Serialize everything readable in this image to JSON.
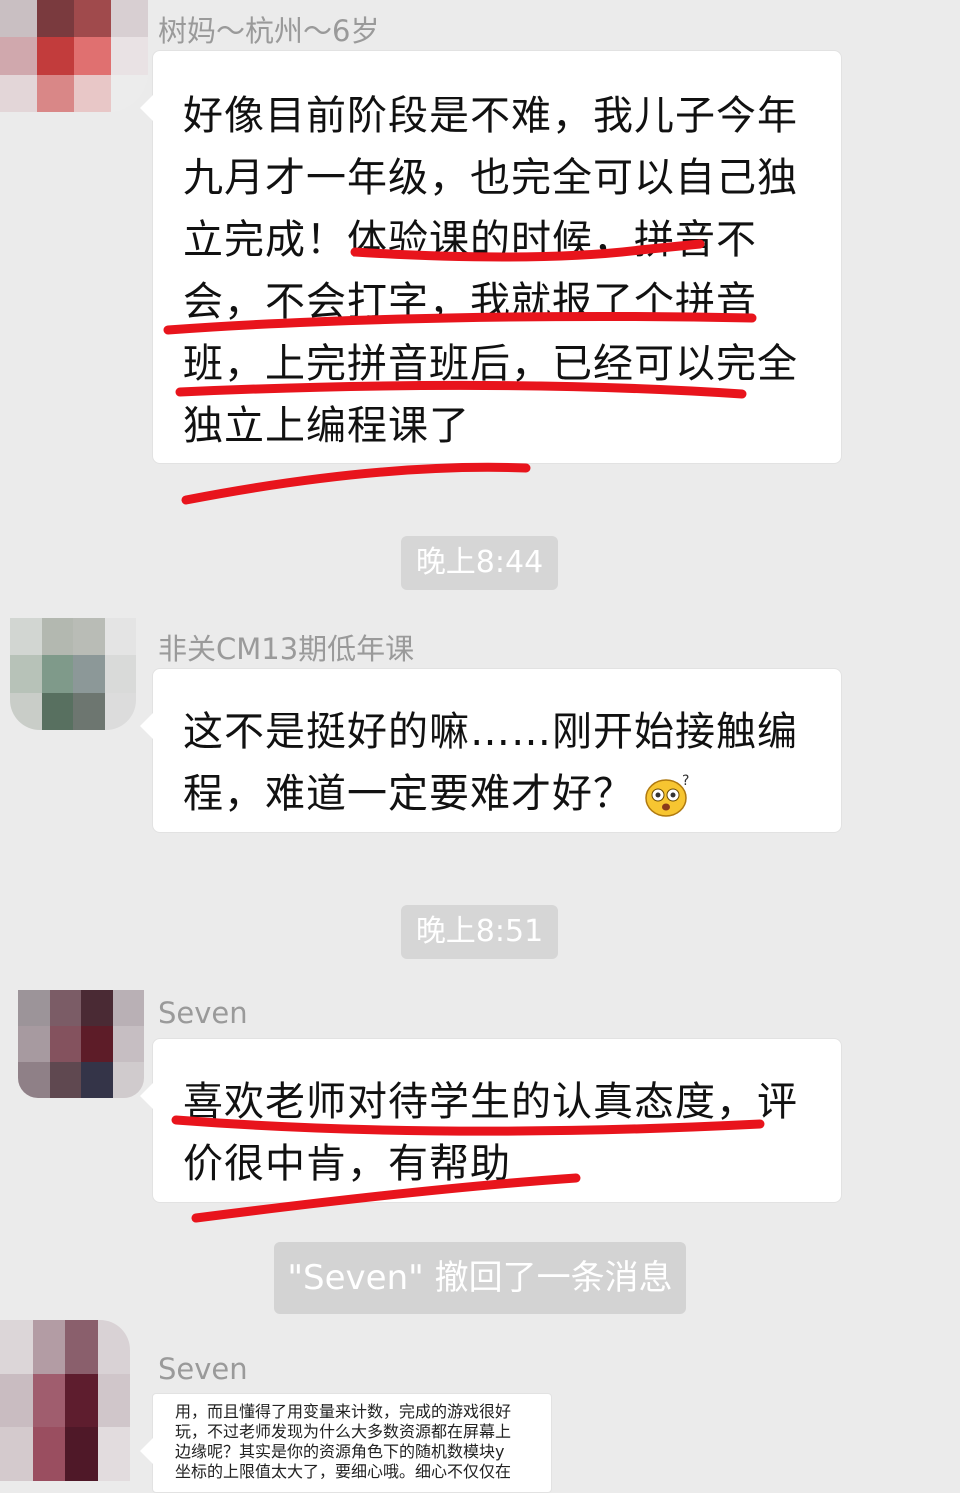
{
  "messages": [
    {
      "sender": "树妈～杭州～6岁",
      "lines": [
        "好像目前阶段是不难，我儿子今年",
        "九月才一年级，也完全可以自己独",
        "立完成！体验课的时候，拼音不",
        "会，不会打字，我就报了个拼音",
        "班，上完拼音班后，已经可以完全",
        "独立上编程课了"
      ]
    },
    {
      "sender": "非关CM13期低年课",
      "lines": [
        "这不是挺好的嘛……刚开始接触编",
        "程，难道一定要难才好？"
      ],
      "emoji_icon": "dizzy-face-emoji-icon"
    },
    {
      "sender": "Seven",
      "lines": [
        "喜欢老师对待学生的认真态度，评",
        "价很中肯，有帮助"
      ]
    },
    {
      "sender": "Seven",
      "screenshot_lines": [
        "用，而且懂得了用变量来计数，完成的游戏很好",
        "玩，不过老师发现为什么大多数资源都在屏幕上",
        "边缘呢？其实是你的资源角色下的随机数模块y",
        "坐标的上限值太大了，要细心哦。细心不仅仅在"
      ]
    }
  ],
  "timestamps": [
    "晚上8:44",
    "晚上8:51"
  ],
  "system_notice": "\"Seven\" 撤回了一条消息",
  "colors": {
    "background": "#ebebeb",
    "bubble": "#ffffff",
    "underline_marker": "#e8141c",
    "time_pill": "#d6d6d6"
  }
}
